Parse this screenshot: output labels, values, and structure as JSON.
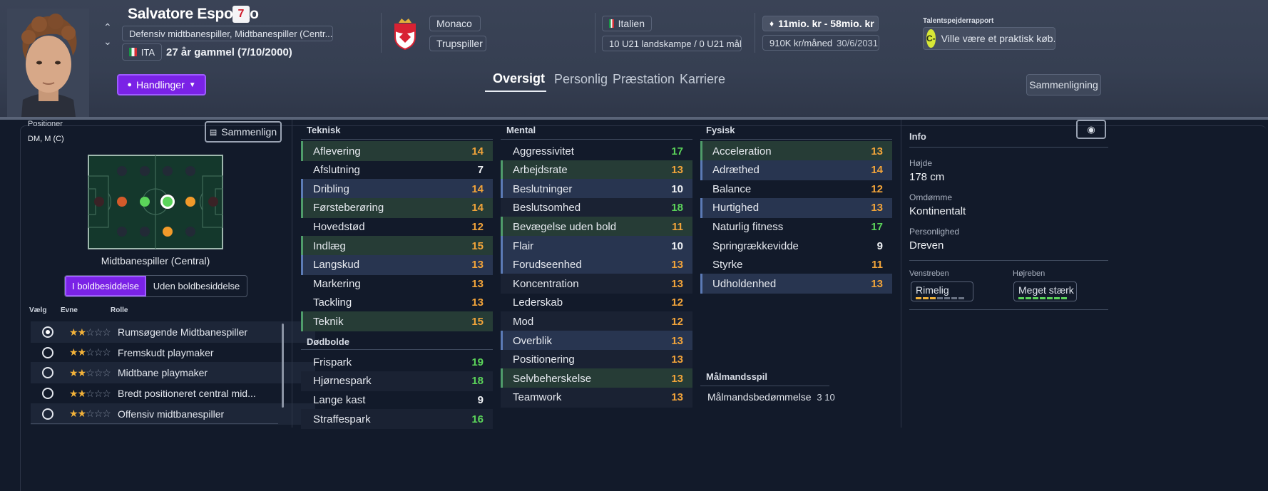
{
  "player": {
    "name": "Salvatore Esposito",
    "number": "7",
    "positions_text": "Defensiv midtbanespiller, Midtbanespiller (Centr...",
    "nationality_code": "ITA",
    "age_text": "27 år gammel (7/10/2000)"
  },
  "club": {
    "name": "Monaco",
    "status": "Trupspiller"
  },
  "nation": {
    "name": "Italien",
    "caps": "10 U21 landskampe / 0 U21 mål"
  },
  "contract": {
    "value": "11mio. kr - 58mio. kr",
    "wage": "910K kr/måned",
    "expiry": "30/6/2031"
  },
  "scout": {
    "title": "Talentspejderrapport",
    "grade": "C-",
    "text": "Ville være et praktisk køb."
  },
  "actions_label": "Handlinger",
  "tabs": [
    "Oversigt",
    "Personlig",
    "Præstation",
    "Karriere"
  ],
  "compare_button": "Sammenligning",
  "positions": {
    "label": "Positioner",
    "value": "DM, M (C)",
    "compare_label": "Sammenlign",
    "selected_position": "Midtbanespiller (Central)",
    "toggle": [
      "I boldbesiddelse",
      "Uden boldbesiddelse"
    ]
  },
  "roles": {
    "headers": [
      "Vælg",
      "Evne",
      "Rolle"
    ],
    "items": [
      {
        "name": "Rumsøgende Midtbanespiller",
        "stars": 2,
        "selected": true
      },
      {
        "name": "Fremskudt playmaker",
        "stars": 2,
        "selected": false
      },
      {
        "name": "Midtbane playmaker",
        "stars": 2,
        "selected": false
      },
      {
        "name": "Bredt positioneret central mid...",
        "stars": 2,
        "selected": false
      },
      {
        "name": "Offensiv midtbanespiller",
        "stars": 2,
        "selected": false
      }
    ]
  },
  "technical": {
    "title": "Teknisk",
    "items": [
      {
        "name": "Aflevering",
        "value": "14",
        "hl": "g"
      },
      {
        "name": "Afslutning",
        "value": "7",
        "hl": ""
      },
      {
        "name": "Dribling",
        "value": "14",
        "hl": "b"
      },
      {
        "name": "Førsteberøring",
        "value": "14",
        "hl": "g"
      },
      {
        "name": "Hovedstød",
        "value": "12",
        "hl": ""
      },
      {
        "name": "Indlæg",
        "value": "15",
        "hl": "g"
      },
      {
        "name": "Langskud",
        "value": "13",
        "hl": "b"
      },
      {
        "name": "Markering",
        "value": "13",
        "hl": ""
      },
      {
        "name": "Tackling",
        "value": "13",
        "hl": ""
      },
      {
        "name": "Teknik",
        "value": "15",
        "hl": "g"
      }
    ]
  },
  "set_pieces": {
    "title": "Dødbolde",
    "items": [
      {
        "name": "Frispark",
        "value": "19"
      },
      {
        "name": "Hjørnespark",
        "value": "18"
      },
      {
        "name": "Lange kast",
        "value": "9"
      },
      {
        "name": "Straffespark",
        "value": "16"
      }
    ]
  },
  "mental": {
    "title": "Mental",
    "items": [
      {
        "name": "Aggressivitet",
        "value": "17",
        "hl": ""
      },
      {
        "name": "Arbejdsrate",
        "value": "13",
        "hl": "g"
      },
      {
        "name": "Beslutninger",
        "value": "10",
        "hl": "b"
      },
      {
        "name": "Beslutsomhed",
        "value": "18",
        "hl": ""
      },
      {
        "name": "Bevægelse uden bold",
        "value": "11",
        "hl": "g"
      },
      {
        "name": "Flair",
        "value": "10",
        "hl": "b"
      },
      {
        "name": "Forudseenhed",
        "value": "13",
        "hl": "b"
      },
      {
        "name": "Koncentration",
        "value": "13",
        "hl": ""
      },
      {
        "name": "Lederskab",
        "value": "12",
        "hl": ""
      },
      {
        "name": "Mod",
        "value": "12",
        "hl": ""
      },
      {
        "name": "Overblik",
        "value": "13",
        "hl": "b"
      },
      {
        "name": "Positionering",
        "value": "13",
        "hl": ""
      },
      {
        "name": "Selvbeherskelse",
        "value": "13",
        "hl": "g"
      },
      {
        "name": "Teamwork",
        "value": "13",
        "hl": ""
      }
    ]
  },
  "physical": {
    "title": "Fysisk",
    "items": [
      {
        "name": "Acceleration",
        "value": "13",
        "hl": "g"
      },
      {
        "name": "Adræthed",
        "value": "14",
        "hl": "b"
      },
      {
        "name": "Balance",
        "value": "12",
        "hl": ""
      },
      {
        "name": "Hurtighed",
        "value": "13",
        "hl": "b"
      },
      {
        "name": "Naturlig fitness",
        "value": "17",
        "hl": ""
      },
      {
        "name": "Springrækkevidde",
        "value": "9",
        "hl": ""
      },
      {
        "name": "Styrke",
        "value": "11",
        "hl": ""
      },
      {
        "name": "Udholdenhed",
        "value": "13",
        "hl": "b"
      }
    ]
  },
  "goalkeeping": {
    "title": "Målmandsspil",
    "label": "Målmandsbedømmelse",
    "value": "3 10"
  },
  "info": {
    "title": "Info",
    "height_label": "Højde",
    "height": "178 cm",
    "reputation_label": "Omdømme",
    "reputation": "Kontinentalt",
    "personality_label": "Personlighed",
    "personality": "Dreven",
    "left_foot_label": "Venstreben",
    "left_foot": "Rimelig",
    "left_foot_level": 3,
    "right_foot_label": "Højreben",
    "right_foot": "Meget stærk",
    "right_foot_level": 7
  },
  "colors": {
    "accent": "#7a22e6",
    "value_orange": "#f2a43a",
    "value_green": "#5bd45a",
    "value_yellow": "#ffc53a",
    "grade": "#d8e836"
  }
}
